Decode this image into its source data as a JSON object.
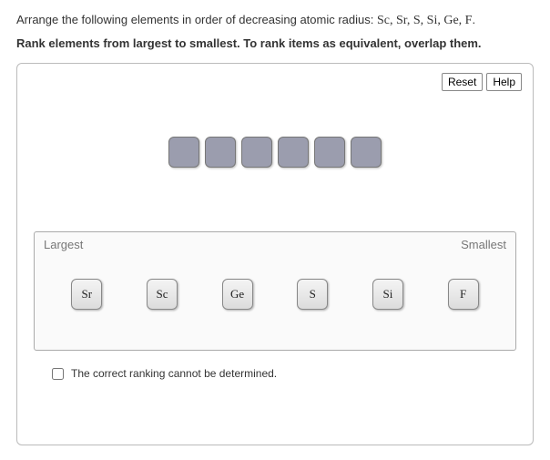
{
  "question": {
    "lead": "Arrange the following elements in order of decreasing atomic radius: ",
    "elements_list": "Sc, Sr, S, Si, Ge, F",
    "period": ".",
    "instructions": "Rank elements from largest to smallest. To rank items as equivalent, overlap them."
  },
  "toolbar": {
    "reset": "Reset",
    "help": "Help"
  },
  "staging_count": 6,
  "zone": {
    "left_label": "Largest",
    "right_label": "Smallest",
    "tiles": [
      "Sr",
      "Sc",
      "Ge",
      "S",
      "Si",
      "F"
    ]
  },
  "cannot_determine": {
    "label": "The correct ranking cannot be determined.",
    "checked": false
  }
}
